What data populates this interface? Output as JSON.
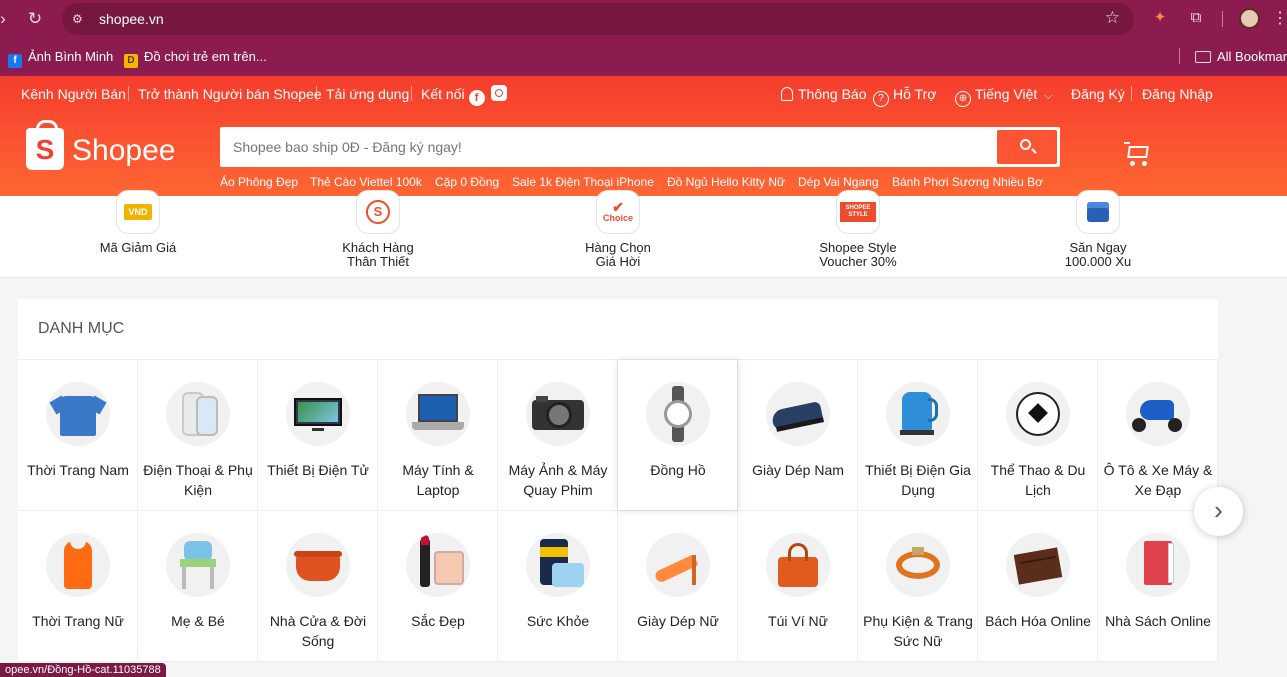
{
  "browser": {
    "url": "shopee.vn",
    "bookmarks": [
      {
        "label": "Ảnh Bình Minh",
        "icon": "facebook-icon"
      },
      {
        "label": "Đồ chơi trẻ em trên...",
        "icon": "toy-store-icon"
      }
    ],
    "all_bookmarks_label": "All Bookmarks",
    "status_url": "opee.vn/Đồng-Hồ-cat.11035788"
  },
  "topnav": {
    "left": [
      "Kênh Người Bán",
      "Trở thành Người bán Shopee",
      "Tải ứng dụng",
      "Kết nối"
    ],
    "notifications": "Thông Báo",
    "support": "Hỗ Trợ",
    "language": "Tiếng Việt",
    "register": "Đăng Ký",
    "login": "Đăng Nhập"
  },
  "header": {
    "logo_text": "Shopee",
    "search_placeholder": "Shopee bao ship 0Đ - Đăng ký ngay!",
    "suggestions": [
      "Áo Phông Đẹp",
      "Thẻ Cào Viettel 100k",
      "Cặp 0 Đồng",
      "Sale 1k Điện Thoại iPhone",
      "Đồ Ngủ Hello Kitty Nữ",
      "Dép Vai Ngang",
      "Bánh Phơi Sương Nhiều Bơ"
    ]
  },
  "quick_links": [
    {
      "label": "Mã Giảm Giá",
      "icon_text": "VND"
    },
    {
      "label": "Khách Hàng\nThân Thiết",
      "icon_text": "S"
    },
    {
      "label": "Hàng Chọn\nGiá Hời",
      "icon_text": "Choice"
    },
    {
      "label": "Shopee Style\nVoucher 30%",
      "icon_text": "SHOPEE STYLE"
    },
    {
      "label": "Săn Ngay\n100.000 Xu",
      "icon_text": ""
    }
  ],
  "categories": {
    "title": "DANH MỤC",
    "items": [
      {
        "label": "Thời Trang Nam",
        "icon": "polo-shirt-icon"
      },
      {
        "label": "Điện Thoại & Phụ Kiện",
        "icon": "smartphone-icon"
      },
      {
        "label": "Thiết Bị Điện Tử",
        "icon": "tv-icon"
      },
      {
        "label": "Máy Tính & Laptop",
        "icon": "laptop-icon"
      },
      {
        "label": "Máy Ảnh & Máy Quay Phim",
        "icon": "camera-icon"
      },
      {
        "label": "Đồng Hồ",
        "icon": "watch-icon"
      },
      {
        "label": "Giày Dép Nam",
        "icon": "men-shoe-icon"
      },
      {
        "label": "Thiết Bị Điện Gia Dụng",
        "icon": "kettle-icon"
      },
      {
        "label": "Thể Thao & Du Lịch",
        "icon": "football-icon"
      },
      {
        "label": "Ô Tô & Xe Máy & Xe Đạp",
        "icon": "scooter-icon"
      },
      {
        "label": "Thời Trang Nữ",
        "icon": "tank-top-icon"
      },
      {
        "label": "Mẹ & Bé",
        "icon": "baby-chair-icon"
      },
      {
        "label": "Nhà Cửa & Đời Sống",
        "icon": "pot-icon"
      },
      {
        "label": "Sắc Đẹp",
        "icon": "makeup-icon"
      },
      {
        "label": "Sức Khỏe",
        "icon": "health-icon"
      },
      {
        "label": "Giày Dép Nữ",
        "icon": "high-heel-icon"
      },
      {
        "label": "Túi Ví Nữ",
        "icon": "handbag-icon"
      },
      {
        "label": "Phụ Kiện & Trang Sức Nữ",
        "icon": "bracelet-icon"
      },
      {
        "label": "Bách Hóa Online",
        "icon": "chocolate-icon"
      },
      {
        "label": "Nhà Sách Online",
        "icon": "book-icon"
      }
    ]
  },
  "colors": {
    "browser": "#8c1c4f",
    "brand": "#f53d2d",
    "brand_light": "#ff6633"
  }
}
